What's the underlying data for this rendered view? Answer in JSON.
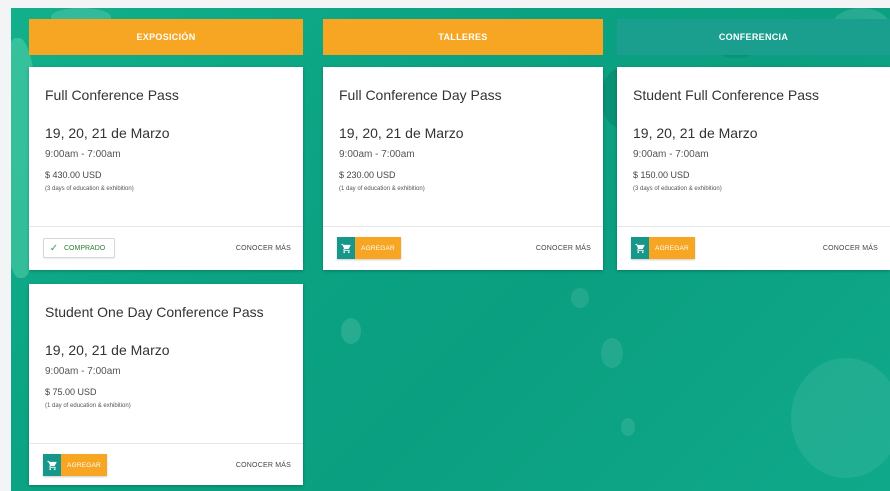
{
  "tabs": [
    {
      "label": "EXPOSICIÓN",
      "color": "#f6a623"
    },
    {
      "label": "TALLERES",
      "color": "#f6a623"
    },
    {
      "label": "CONFERENCIA",
      "color": "#1a9f8f"
    }
  ],
  "cards": [
    {
      "title": "Full Conference Pass",
      "date": "19, 20, 21 de Marzo",
      "time": "9:00am - 7:00am",
      "price": "$ 430.00 USD",
      "note": "(3 days of education & exhibition)",
      "action": "COMPRADO",
      "more": "CONOCER MÁS"
    },
    {
      "title": "Full Conference Day Pass",
      "date": "19, 20, 21 de Marzo",
      "time": "9:00am - 7:00am",
      "price": "$ 230.00 USD",
      "note": "(1 day of education & exhibition)",
      "action": "AGREGAR",
      "more": "CONOCER MÁS"
    },
    {
      "title": "Student Full Conference Pass",
      "date": "19, 20, 21 de Marzo",
      "time": "9:00am - 7:00am",
      "price": "$ 150.00 USD",
      "note": "(3 days of education & exhibition)",
      "action": "AGREGAR",
      "more": "CONOCER MÁS"
    },
    {
      "title": "Student One Day Conference Pass",
      "date": "19, 20, 21 de Marzo",
      "time": "9:00am - 7:00am",
      "price": "$ 75.00 USD",
      "note": "(1 day of education & exhibition)",
      "action": "AGREGAR",
      "more": "CONOCER MÁS"
    }
  ],
  "icons": {
    "check": "check-icon",
    "cart": "shopping-cart-icon"
  },
  "colors": {
    "accent_orange": "#f6a623",
    "accent_teal": "#1a9f8f",
    "background_green": "#0ba383"
  }
}
